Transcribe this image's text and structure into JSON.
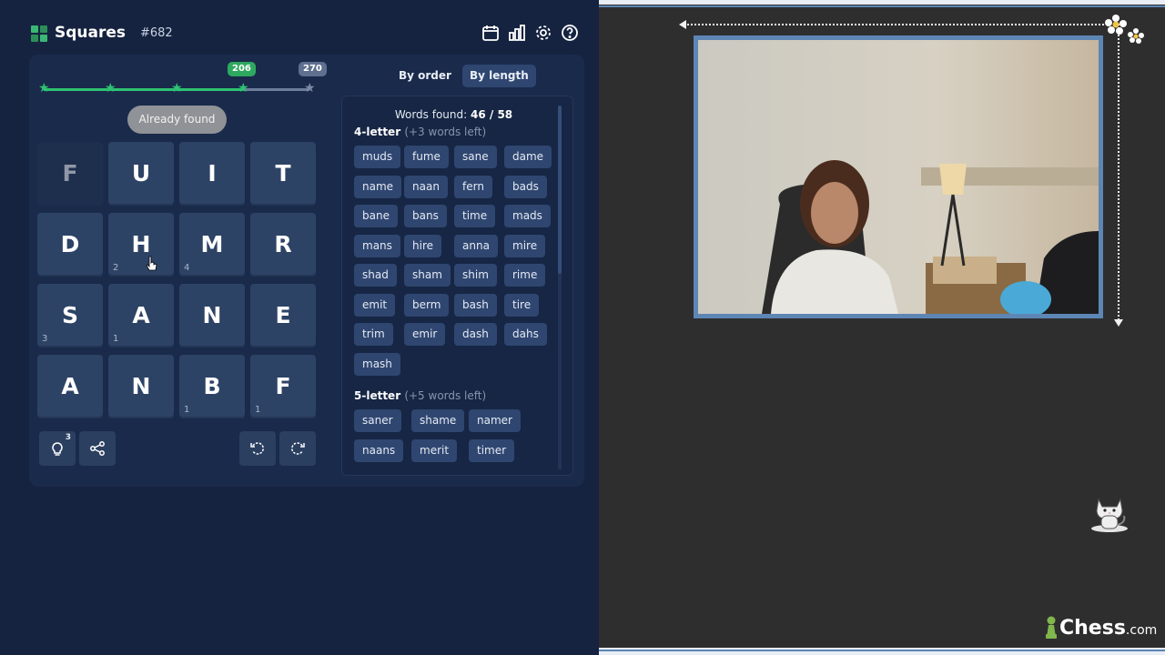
{
  "app": {
    "title": "Squares",
    "puzzle_number": "#682"
  },
  "header_icons": [
    "calendar-icon",
    "stats-icon",
    "gear-icon",
    "help-icon"
  ],
  "progress": {
    "milestone_score": "206",
    "max_score": "270",
    "stars_reached": 4,
    "stars_total": 5
  },
  "toast": "Already found",
  "grid": [
    [
      {
        "letter": "F",
        "count": "",
        "dim": true
      },
      {
        "letter": "U",
        "count": ""
      },
      {
        "letter": "I",
        "count": ""
      },
      {
        "letter": "T",
        "count": ""
      }
    ],
    [
      {
        "letter": "D",
        "count": ""
      },
      {
        "letter": "H",
        "count": "2"
      },
      {
        "letter": "M",
        "count": "4"
      },
      {
        "letter": "R",
        "count": ""
      }
    ],
    [
      {
        "letter": "S",
        "count": "3"
      },
      {
        "letter": "A",
        "count": "1"
      },
      {
        "letter": "N",
        "count": ""
      },
      {
        "letter": "E",
        "count": ""
      }
    ],
    [
      {
        "letter": "A",
        "count": ""
      },
      {
        "letter": "N",
        "count": ""
      },
      {
        "letter": "B",
        "count": "1"
      },
      {
        "letter": "F",
        "count": "1"
      }
    ]
  ],
  "bottom_buttons": {
    "hint_count": "3"
  },
  "sort": {
    "by_order": "By order",
    "by_length": "By length"
  },
  "words": {
    "found_label": "Words found:",
    "found_value": "46 / 58",
    "sections": [
      {
        "title": "4-letter",
        "note": "(+3 words left)",
        "words": [
          "muds",
          "fume",
          "sane",
          "dame",
          "name",
          "naan",
          "fern",
          "bads",
          "bane",
          "bans",
          "time",
          "mads",
          "mans",
          "hire",
          "anna",
          "mire",
          "shad",
          "sham",
          "shim",
          "rime",
          "emit",
          "berm",
          "bash",
          "tire",
          "trim",
          "emir",
          "dash",
          "dahs",
          "mash"
        ]
      },
      {
        "title": "5-letter",
        "note": "(+5 words left)",
        "words": [
          "saner",
          "shame",
          "namer",
          "naans",
          "merit",
          "timer"
        ]
      }
    ]
  },
  "brand": {
    "name": "Chess",
    "suffix": ".com"
  },
  "colors": {
    "panel": "#152340",
    "tile": "#2d4366",
    "accent_green": "#2ec271",
    "frame_blue": "#5d86b5"
  }
}
